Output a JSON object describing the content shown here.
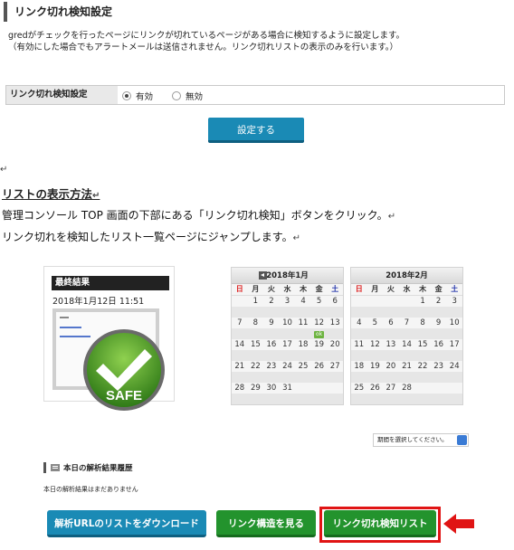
{
  "header": {
    "title": "リンク切れ検知設定"
  },
  "description": {
    "line1": "gredがチェックを行ったページにリンクが切れているページがある場合に検知するように設定します。",
    "line2": "（有効にした場合でもアラートメールは送信されません。リンク切れリストの表示のみを行います。）"
  },
  "setting": {
    "label": "リンク切れ検知設定",
    "option_enabled": "有効",
    "option_disabled": "無効",
    "selected": "有効"
  },
  "submit_label": "設定する",
  "return_mark": "↵",
  "section": {
    "heading": "リストの表示方法",
    "para1": "管理コンソール TOP 画面の下部にある「リンク切れ検知」ボタンをクリック。",
    "para2": "リンク切れを検知したリスト一覧ページにジャンプします。"
  },
  "result_card": {
    "title": "最終結果",
    "date": "2018年1月12日 11:51",
    "safe_label": "SAFE"
  },
  "calendars": [
    {
      "title": "2018年1月",
      "weekdays": [
        "日",
        "月",
        "火",
        "水",
        "木",
        "金",
        "土"
      ],
      "weeks": [
        [
          "",
          "1",
          "2",
          "3",
          "4",
          "5",
          "6"
        ],
        [
          "7",
          "8",
          "9",
          "10",
          "11",
          "12",
          "13"
        ],
        [
          "14",
          "15",
          "16",
          "17",
          "18",
          "19",
          "20"
        ],
        [
          "21",
          "22",
          "23",
          "24",
          "25",
          "26",
          "27"
        ],
        [
          "28",
          "29",
          "30",
          "31",
          "",
          "",
          ""
        ]
      ],
      "ok_badge": "ok"
    },
    {
      "title": "2018年2月",
      "weekdays": [
        "日",
        "月",
        "火",
        "水",
        "木",
        "金",
        "土"
      ],
      "weeks": [
        [
          "",
          "",
          "",
          "",
          "1",
          "2",
          "3"
        ],
        [
          "4",
          "5",
          "6",
          "7",
          "8",
          "9",
          "10"
        ],
        [
          "11",
          "12",
          "13",
          "14",
          "15",
          "16",
          "17"
        ],
        [
          "18",
          "19",
          "20",
          "21",
          "22",
          "23",
          "24"
        ],
        [
          "25",
          "26",
          "27",
          "28",
          "",
          "",
          ""
        ]
      ]
    }
  ],
  "period_select": {
    "placeholder": "期間を選択してください。"
  },
  "history": {
    "title": "本日の解析結果履歴",
    "empty": "本日の解析結果はまだありません"
  },
  "buttons": {
    "download": "解析URLのリストをダウンロード",
    "link_structure": "リンク構造を見る",
    "broken_list": "リンク切れ検知リスト"
  },
  "colors": {
    "blue_button": "#1a8ab5",
    "green_button": "#23932d",
    "highlight_red": "#e01414"
  }
}
